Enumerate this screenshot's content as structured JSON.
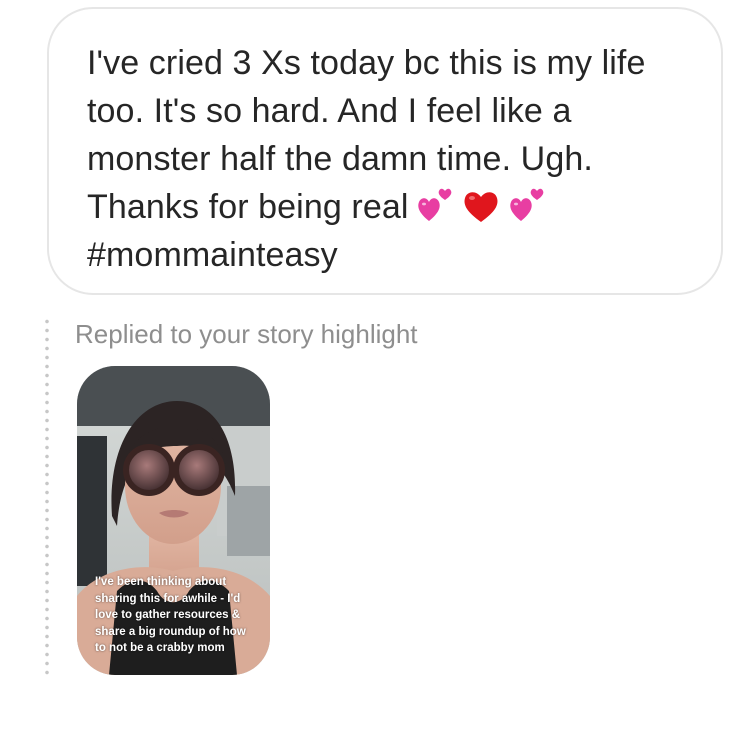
{
  "message": {
    "lines": [
      "I've cried 3 Xs today bc this is my life",
      "too. It's so hard. And I feel like a",
      "monster half the damn time. Ugh.",
      "Thanks for being real",
      "#mommainteasy"
    ],
    "emojis": [
      "two-hearts-icon",
      "red-heart-icon",
      "two-hearts-icon"
    ]
  },
  "reply": {
    "caption": "Replied to your story highlight"
  },
  "story": {
    "overlay_lines": [
      "I've been thinking about",
      "sharing this for awhile - I'd",
      "love to gather resources &",
      "share a big roundup of how",
      "to not be a crabby mom"
    ]
  },
  "colors": {
    "text": "#262626",
    "caption": "#8e8e8e",
    "bubble_border": "#e6e6e6",
    "heart_red": "#e0161d",
    "heart_pink": "#e83ea2"
  }
}
